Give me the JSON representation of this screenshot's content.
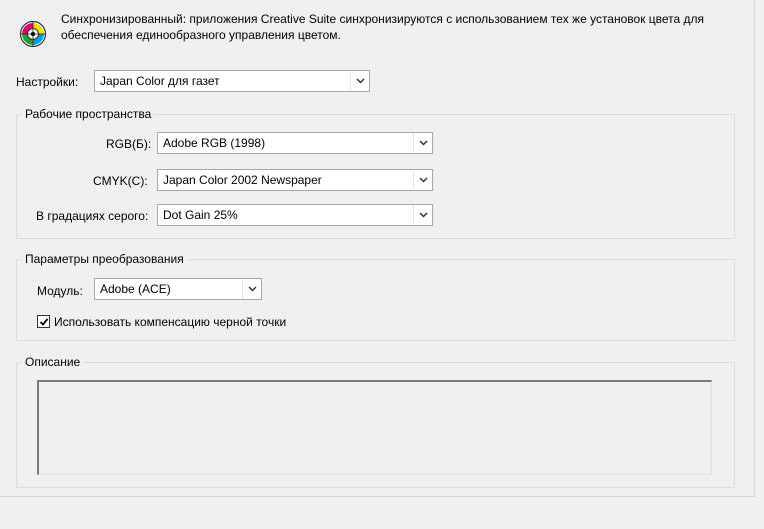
{
  "sync_message": "Синхронизированный: приложения Creative Suite синхронизируются с использованием тех же установок цвета для обеспечения единообразного управления цветом.",
  "settings": {
    "label": "Настройки:",
    "value": "Japan Color для газет"
  },
  "working_spaces": {
    "title": "Рабочие пространства",
    "rgb": {
      "label": "RGB(Б):",
      "value": "Adobe RGB (1998)"
    },
    "cmyk": {
      "label": "CMYK(C):",
      "value": "Japan Color 2002 Newspaper"
    },
    "gray": {
      "label": "В градациях серого:",
      "value": "Dot Gain 25%"
    }
  },
  "conversion": {
    "title": "Параметры преобразования",
    "engine": {
      "label": "Модуль:",
      "value": "Adobe (ACE)"
    },
    "black_point": {
      "label": "Использовать компенсацию черной точки",
      "checked": true
    }
  },
  "description": {
    "title": "Описание",
    "text": ""
  },
  "icons": {
    "sync": "color-sync-icon",
    "dropdown": "chevron-down-icon",
    "check": "checkmark-icon"
  }
}
